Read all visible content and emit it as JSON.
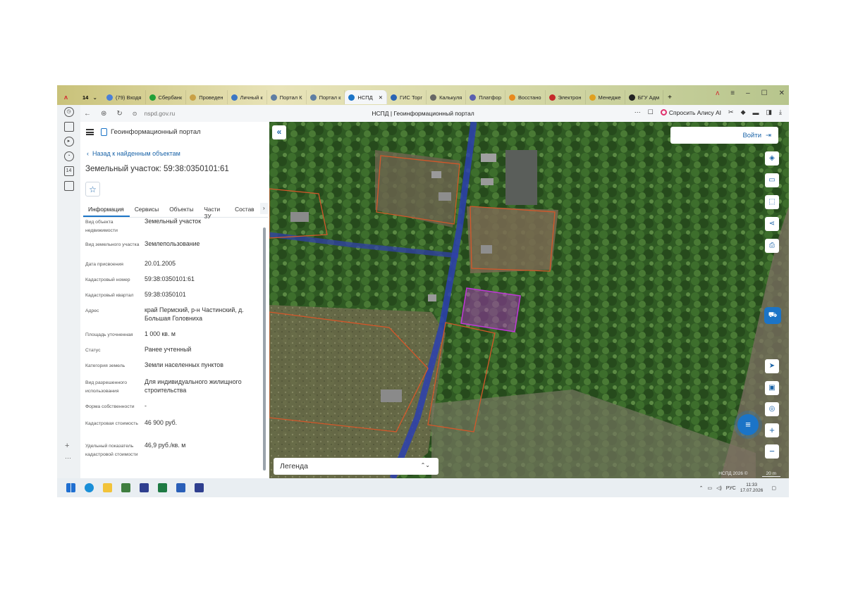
{
  "browser": {
    "tab_count": "14",
    "tabs": [
      {
        "label": "(79) Входя",
        "color": "#4a7fd8"
      },
      {
        "label": "Сбербанк",
        "color": "#21a038"
      },
      {
        "label": "Проведен",
        "color": "#c8a046"
      },
      {
        "label": "Личный к",
        "color": "#3b76c4"
      },
      {
        "label": "Портал К",
        "color": "#5f7ea3"
      },
      {
        "label": "Портал к",
        "color": "#5f7ea3"
      },
      {
        "label": "НСПД",
        "color": "#1b74c7",
        "active": true
      },
      {
        "label": "ГИС Торг",
        "color": "#2a64b4"
      },
      {
        "label": "Калькуля",
        "color": "#666666"
      },
      {
        "label": "Платфор",
        "color": "#5a5fb0"
      },
      {
        "label": "Восстано",
        "color": "#e88a1d"
      },
      {
        "label": "Электрон",
        "color": "#c52a2a"
      },
      {
        "label": "Менедже",
        "color": "#e0a020"
      },
      {
        "label": "БГУ Адм",
        "color": "#222222"
      }
    ],
    "url": "nspd.gov.ru",
    "page_title": "НСПД | Геоинформационный портал",
    "alice_label": "Спросить Алису AI"
  },
  "panel": {
    "brand": "Геоинформационный портал",
    "back_link": "Назад к найденным объектам",
    "title": "Земельный участок: 59:38:0350101:61",
    "tabs": [
      "Информация",
      "Сервисы",
      "Объекты",
      "Части ЗУ",
      "Состав"
    ],
    "rows": [
      {
        "key": "Вид объекта недвижимости",
        "value": "Земельный участок"
      },
      {
        "key": "Вид земельного участка",
        "value": "Землепользование"
      },
      {
        "key": "Дата присвоения",
        "value": "20.01.2005"
      },
      {
        "key": "Кадастровый номер",
        "value": "59:38:0350101:61"
      },
      {
        "key": "Кадастровый квартал",
        "value": "59:38:0350101"
      },
      {
        "key": "Адрес",
        "value": "край Пермский, р-н Частинский, д. Большая Головниха"
      },
      {
        "key": "Площадь уточненная",
        "value": "1 000 кв. м"
      },
      {
        "key": "Статус",
        "value": "Ранее учтенный"
      },
      {
        "key": "Категория земель",
        "value": "Земли населенных пунктов"
      },
      {
        "key": "Вид разрешенного использования",
        "value": "Для индивидуального жилищного строительства"
      },
      {
        "key": "Форма собственности",
        "value": "-"
      },
      {
        "key": "Кадастровая стоимость",
        "value": "46 900 руб."
      },
      {
        "key": "Удельный показатель кадастровой стоимости",
        "value": "46,9 руб./кв. м"
      }
    ]
  },
  "map": {
    "login_label": "Войти",
    "legend_label": "Легенда",
    "copyright": "НСПД 2026 ©",
    "scale_label": "20 m"
  },
  "taskbar": {
    "lang": "РУС",
    "time": "11:33",
    "date": "17.07.2026"
  }
}
